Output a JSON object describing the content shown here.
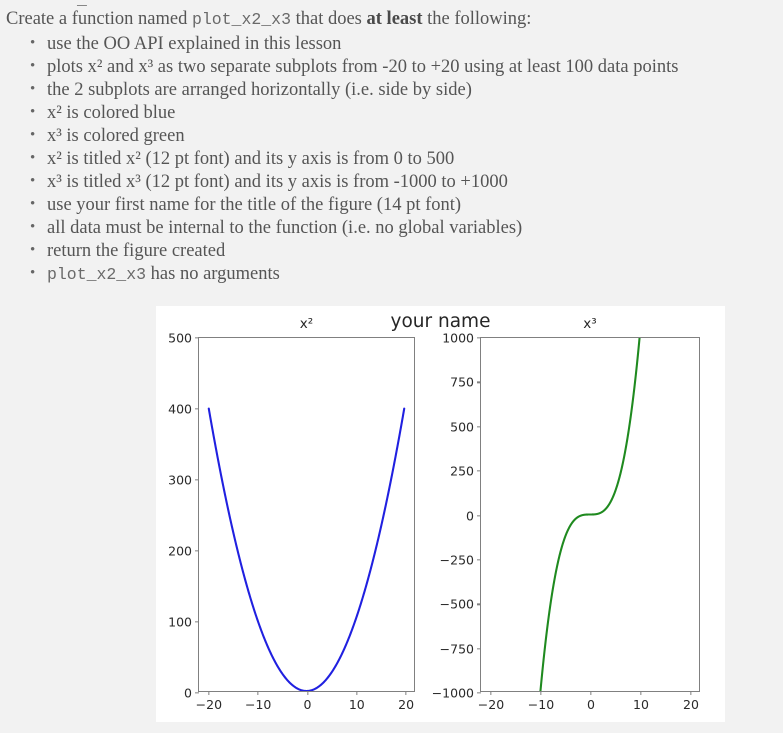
{
  "top_sliver": "_",
  "prose": {
    "intro_before": "Create a function named ",
    "intro_code": "plot_x2_x3",
    "intro_mid": " that does ",
    "intro_bold": "at least",
    "intro_after": " the following:",
    "requirements": [
      "use the OO API explained in this lesson",
      "plots x² and x³ as two separate subplots from -20 to +20 using at least 100 data points",
      "the 2 subplots are arranged horizontally (i.e. side by side)",
      "x² is colored blue",
      "x³ is colored green",
      "x² is titled x² (12 pt font) and its y axis is from 0 to 500",
      "x³ is titled x³ (12 pt font) and its y axis is from -1000 to +1000",
      "use your first name for the title of the figure (14 pt font)",
      "all data must be internal to the function (i.e. no global variables)",
      "return the figure created",
      "plot_x2_x3 has no arguments"
    ],
    "code_item_index": 10
  },
  "colors": {
    "background": "#f2f2f2",
    "figure_background": "#ffffff",
    "text": "#555555",
    "axis": "#808080",
    "series_x2": "#2020e0",
    "series_x3": "#1f8a1f",
    "tick_text": "#2a2a2a"
  },
  "chart_data": {
    "type": "line",
    "title": "your name",
    "figure_title_fontsize_pt": 14,
    "subplot_title_fontsize_pt": 12,
    "layout": "1 row x 2 columns (horizontal)",
    "grid": false,
    "legend": "none",
    "subplots": [
      {
        "title": "x²",
        "color": "#2020e0",
        "xlabel": "",
        "ylabel": "",
        "xlim": [
          -22,
          22
        ],
        "ylim": [
          0,
          500
        ],
        "xticks": [
          -20,
          -10,
          0,
          10,
          20
        ],
        "xticklabels": [
          "−20",
          "−10",
          "0",
          "10",
          "20"
        ],
        "yticks": [
          0,
          100,
          200,
          300,
          400,
          500
        ],
        "yticklabels": [
          "0",
          "100",
          "200",
          "300",
          "400",
          "500"
        ],
        "series": [
          {
            "name": "x²",
            "expression": "y = x^2",
            "x": [
              -20,
              -18,
              -16,
              -14,
              -12,
              -10,
              -8,
              -6,
              -4,
              -2,
              0,
              2,
              4,
              6,
              8,
              10,
              12,
              14,
              16,
              18,
              20
            ],
            "y": [
              400,
              324,
              256,
              196,
              144,
              100,
              64,
              36,
              16,
              4,
              0,
              4,
              16,
              36,
              64,
              100,
              144,
              196,
              256,
              324,
              400
            ]
          }
        ]
      },
      {
        "title": "x³",
        "color": "#1f8a1f",
        "xlabel": "",
        "ylabel": "",
        "xlim": [
          -22,
          22
        ],
        "ylim": [
          -1000,
          1000
        ],
        "xticks": [
          -20,
          -10,
          0,
          10,
          20
        ],
        "xticklabels": [
          "−20",
          "−10",
          "0",
          "10",
          "20"
        ],
        "yticks": [
          -1000,
          -750,
          -500,
          -250,
          0,
          250,
          500,
          750,
          1000
        ],
        "yticklabels": [
          "−1000",
          "−750",
          "−500",
          "−250",
          "0",
          "250",
          "500",
          "750",
          "1000"
        ],
        "series": [
          {
            "name": "x³",
            "expression": "y = x^3",
            "x": [
              -10,
              -9,
              -8,
              -7,
              -6,
              -5,
              -4,
              -3,
              -2,
              -1,
              0,
              1,
              2,
              3,
              4,
              5,
              6,
              7,
              8,
              9,
              10
            ],
            "y": [
              -1000,
              -729,
              -512,
              -343,
              -216,
              -125,
              -64,
              -27,
              -8,
              -1,
              0,
              1,
              8,
              27,
              64,
              125,
              216,
              343,
              512,
              729,
              1000
            ]
          }
        ]
      }
    ]
  }
}
